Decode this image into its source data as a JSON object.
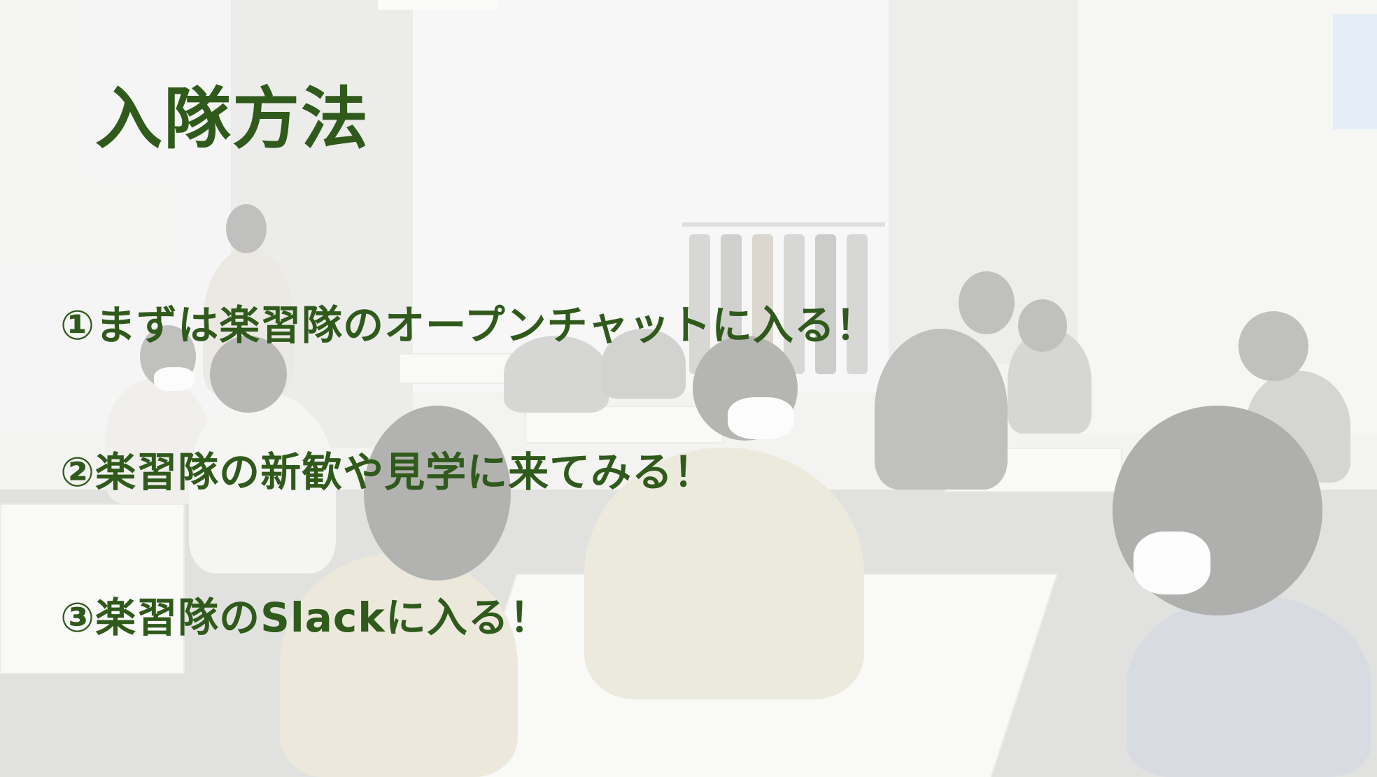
{
  "slide": {
    "title": "入隊方法",
    "steps": [
      {
        "text": "①まずは楽習隊のオープンチャットに入る！"
      },
      {
        "text": "②楽習隊の新歓や見学に来てみる！"
      },
      {
        "text": "③楽習隊のSlackに入る！"
      }
    ]
  },
  "colors": {
    "heading_text": "#2f5a1b",
    "background_tint": "#e9eae7"
  }
}
